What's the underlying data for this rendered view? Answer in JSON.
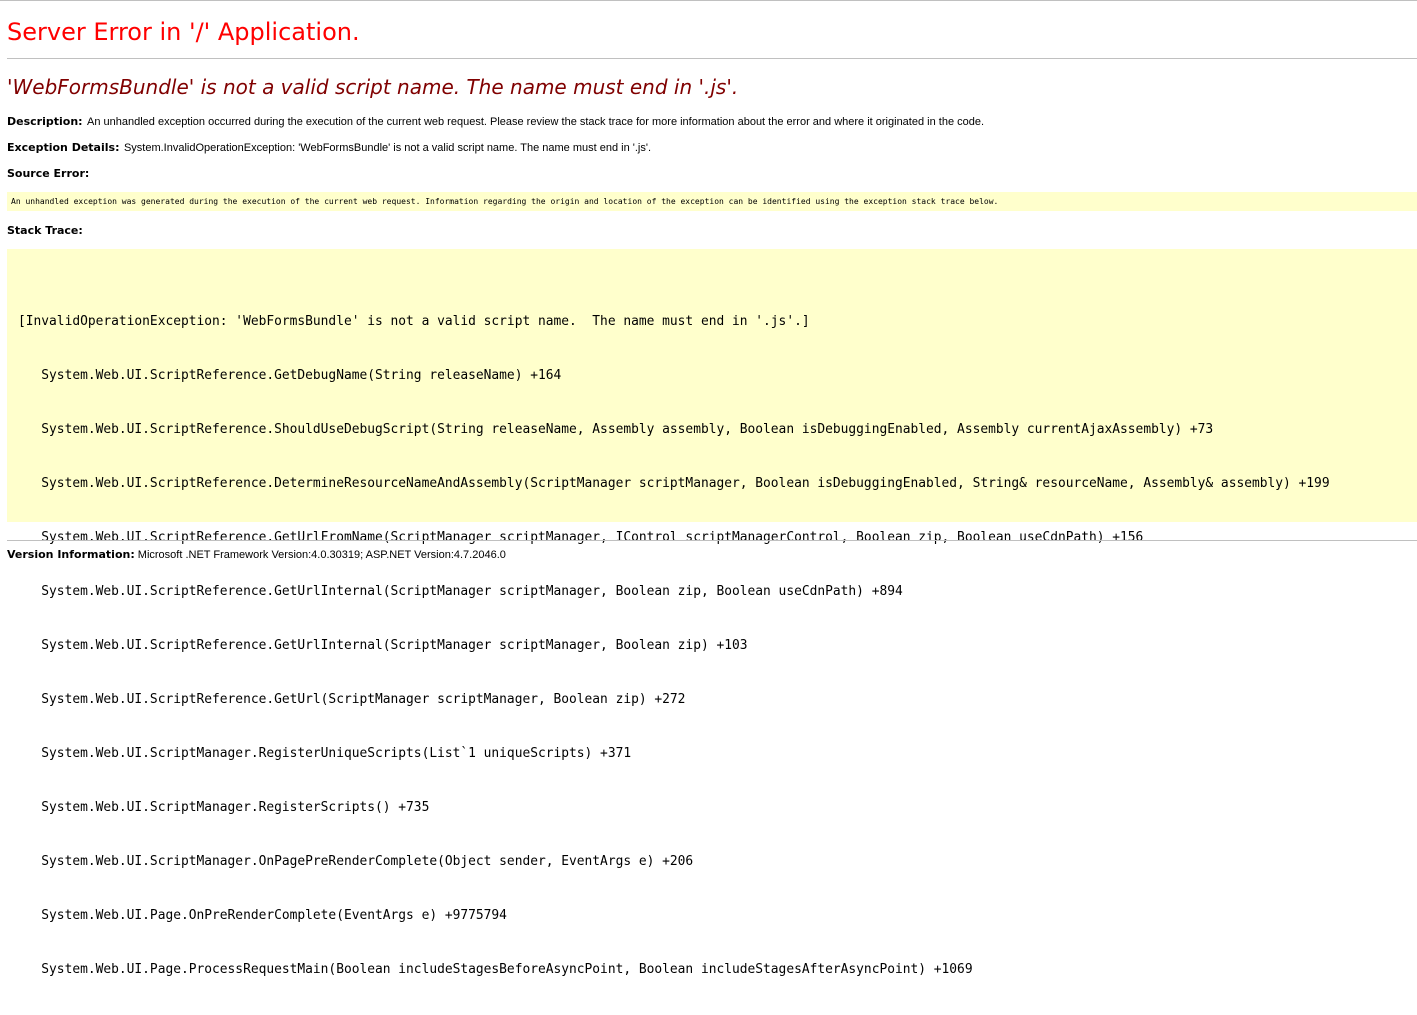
{
  "title": "Server Error in '/' Application.",
  "error_message": "'WebFormsBundle' is not a valid script name.  The name must end in '.js'.",
  "description": {
    "label": "Description:",
    "text": "An unhandled exception occurred during the execution of the current web request. Please review the stack trace for more information about the error and where it originated in the code."
  },
  "exception_details": {
    "label": "Exception Details:",
    "text": "System.InvalidOperationException: 'WebFormsBundle' is not a valid script name.  The name must end in '.js'."
  },
  "source_error": {
    "label": "Source Error:",
    "text": "An unhandled exception was generated during the execution of the current web request. Information regarding the origin and location of the exception can be identified using the exception stack trace below."
  },
  "stack_trace": {
    "label": "Stack Trace:",
    "lines": [
      "[InvalidOperationException: 'WebFormsBundle' is not a valid script name.  The name must end in '.js'.]",
      "   System.Web.UI.ScriptReference.GetDebugName(String releaseName) +164",
      "   System.Web.UI.ScriptReference.ShouldUseDebugScript(String releaseName, Assembly assembly, Boolean isDebuggingEnabled, Assembly currentAjaxAssembly) +73",
      "   System.Web.UI.ScriptReference.DetermineResourceNameAndAssembly(ScriptManager scriptManager, Boolean isDebuggingEnabled, String& resourceName, Assembly& assembly) +199",
      "   System.Web.UI.ScriptReference.GetUrlFromName(ScriptManager scriptManager, IControl scriptManagerControl, Boolean zip, Boolean useCdnPath) +156",
      "   System.Web.UI.ScriptReference.GetUrlInternal(ScriptManager scriptManager, Boolean zip, Boolean useCdnPath) +894",
      "   System.Web.UI.ScriptReference.GetUrlInternal(ScriptManager scriptManager, Boolean zip) +103",
      "   System.Web.UI.ScriptReference.GetUrl(ScriptManager scriptManager, Boolean zip) +272",
      "   System.Web.UI.ScriptManager.RegisterUniqueScripts(List`1 uniqueScripts) +371",
      "   System.Web.UI.ScriptManager.RegisterScripts() +735",
      "   System.Web.UI.ScriptManager.OnPagePreRenderComplete(Object sender, EventArgs e) +206",
      "   System.Web.UI.Page.OnPreRenderComplete(EventArgs e) +9775794",
      "   System.Web.UI.Page.ProcessRequestMain(Boolean includeStagesBeforeAsyncPoint, Boolean includeStagesAfterAsyncPoint) +1069"
    ]
  },
  "version_info": {
    "label": "Version Information:",
    "text": " Microsoft .NET Framework Version:4.0.30319; ASP.NET Version:4.7.2046.0"
  },
  "colors": {
    "title": "#ff0000",
    "error_message": "#800000",
    "code_background": "#ffffcc",
    "rule": "#c0c0c0"
  }
}
